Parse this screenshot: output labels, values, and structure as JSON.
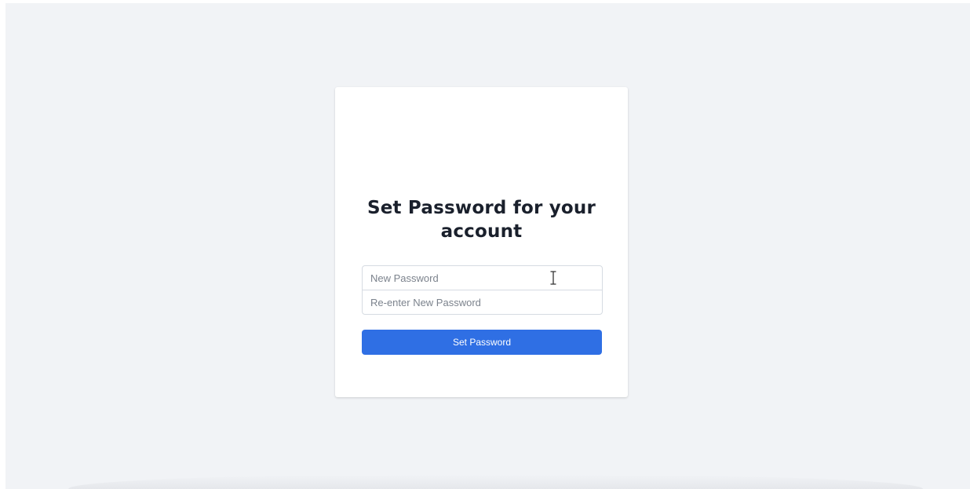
{
  "form": {
    "title": "Set Password for your account",
    "new_password": {
      "placeholder": "New Password",
      "value": ""
    },
    "confirm_password": {
      "placeholder": "Re-enter New Password",
      "value": ""
    },
    "submit_label": "Set Password"
  },
  "colors": {
    "background": "#f1f3f6",
    "card": "#ffffff",
    "accent": "#2f6fe4",
    "title_text": "#1a202c"
  },
  "cursor": {
    "icon": "text-cursor-icon"
  }
}
